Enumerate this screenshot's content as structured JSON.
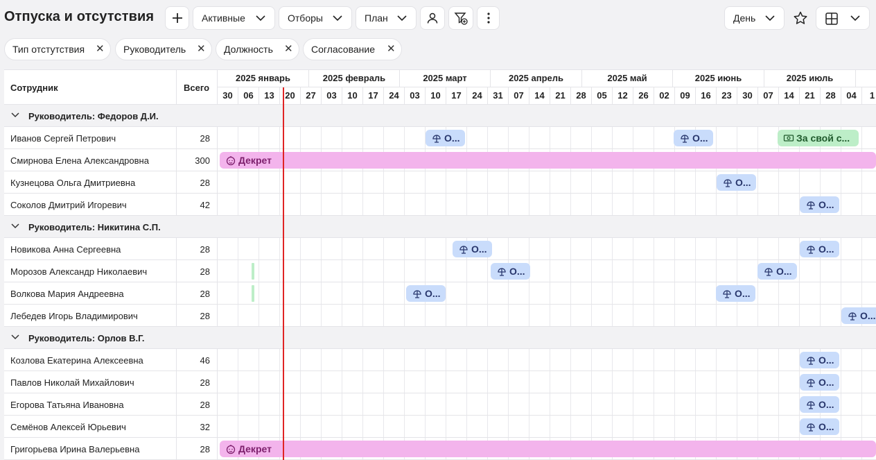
{
  "header": {
    "title": "Отпуска и отсутствия",
    "filter_active": "Активные",
    "filter_selections": "Отборы",
    "filter_plan": "План",
    "scale": "День"
  },
  "chips": [
    {
      "label": "Тип отстутствия"
    },
    {
      "label": "Руководитель"
    },
    {
      "label": "Должность"
    },
    {
      "label": "Согласование"
    }
  ],
  "columns": {
    "employee": "Сотрудник",
    "total": "Всего"
  },
  "months": [
    "2025 январь",
    "2025 февраль",
    "2025 март",
    "2025 апрель",
    "2025 май",
    "2025 июнь",
    "2025 июль"
  ],
  "weeks": [
    "30",
    "06",
    "13",
    "20",
    "27",
    "03",
    "10",
    "17",
    "24",
    "03",
    "10",
    "17",
    "24",
    "31",
    "07",
    "14",
    "21",
    "28",
    "05",
    "12",
    "26",
    "02",
    "09",
    "16",
    "23",
    "30",
    "07",
    "14",
    "21",
    "28",
    "04",
    "1"
  ],
  "groups": [
    {
      "title": "Руководитель: Федоров Д.И."
    },
    {
      "title": "Руководитель: Никитина С.П."
    },
    {
      "title": "Руководитель: Орлов В.Г."
    }
  ],
  "employees": [
    {
      "name": "Иванов Сергей Петрович",
      "total": "28"
    },
    {
      "name": "Смирнова Елена Александровна",
      "total": "300"
    },
    {
      "name": "Кузнецова Ольга Дмитриевна",
      "total": "28"
    },
    {
      "name": "Соколов Дмитрий Игоревич",
      "total": "42"
    },
    {
      "name": "Новикова Анна Сергеевна",
      "total": "28"
    },
    {
      "name": "Морозов Александр Николаевич",
      "total": "28"
    },
    {
      "name": "Волкова Мария Андреевна",
      "total": "28"
    },
    {
      "name": "Лебедев Игорь Владимирович",
      "total": "28"
    },
    {
      "name": "Козлова Екатерина Алексеевна",
      "total": "46"
    },
    {
      "name": "Павлов Николай Михайлович",
      "total": "28"
    },
    {
      "name": "Егорова Татьяна Ивановна",
      "total": "28"
    },
    {
      "name": "Семёнов Алексей Юрьевич",
      "total": "32"
    },
    {
      "name": "Григорьева Ирина Валерьевна",
      "total": "28"
    }
  ],
  "bars": {
    "vacation_short": "О...",
    "decret": "Декрет",
    "own_expense": "За свой с..."
  },
  "colors": {
    "vacation": "#c9dcfb",
    "decret": "#f3b4ec",
    "own_expense": "#bdeec8",
    "today_line": "#e02424"
  }
}
